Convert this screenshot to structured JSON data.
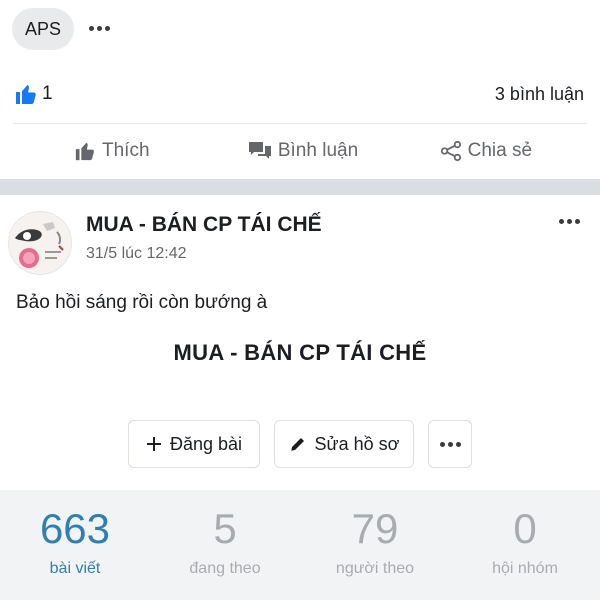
{
  "top": {
    "chip_label": "APS"
  },
  "reactions": {
    "like_count": "1",
    "comment_count": "3 bình luận"
  },
  "actions": {
    "like_label": "Thích",
    "comment_label": "Bình luận",
    "share_label": "Chia sẻ"
  },
  "post": {
    "page_name": "MUA - BÁN CP TÁI CHẾ",
    "time": "31/5 lúc 12:42",
    "text": "Bảo hồi sáng rồi còn bướng à",
    "title": "MUA - BÁN CP TÁI CHẾ"
  },
  "buttons": {
    "post_label": "Đăng bài",
    "edit_label": "Sửa hồ sơ"
  },
  "stats": [
    {
      "value": "663",
      "label": "bài viết"
    },
    {
      "value": "5",
      "label": "đang theo"
    },
    {
      "value": "79",
      "label": "người theo"
    },
    {
      "value": "0",
      "label": "hội nhóm"
    }
  ],
  "colors": {
    "accent": "#2d7fb5",
    "like_blue": "#1877f2",
    "muted": "#65676b"
  },
  "icons": [
    "thumbs-up-icon",
    "chat-bubble-icon",
    "share-icon",
    "plus-icon",
    "pencil-icon",
    "more-icon"
  ]
}
